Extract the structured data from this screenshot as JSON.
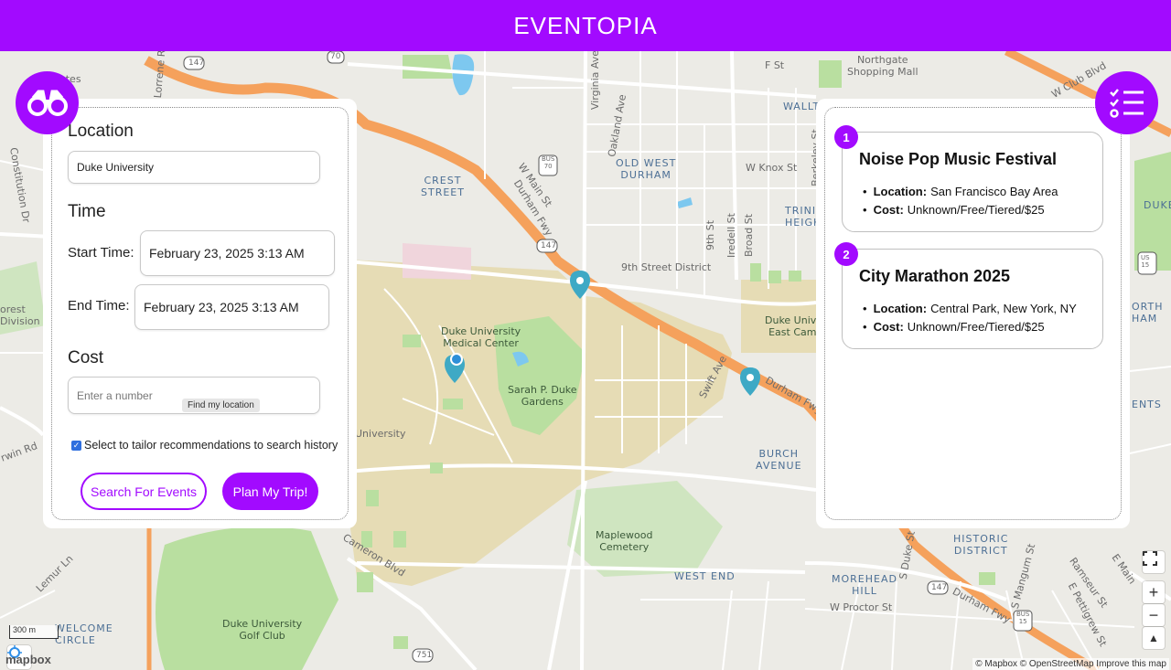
{
  "app": {
    "title": "EVENTOPIA",
    "brand_color": "#a20aff"
  },
  "search_panel": {
    "location_heading": "Location",
    "location_value": "Duke University",
    "time_heading": "Time",
    "start_label": "Start Time:",
    "start_value": "February 23, 2025 3:13 AM",
    "end_label": "End Time:",
    "end_value": "February 23, 2025 3:13 AM",
    "cost_heading": "Cost",
    "cost_placeholder": "Enter a number",
    "tooltip": "Find my location",
    "checkbox_label": "Select to tailor recommendations to search history",
    "checkbox_checked": true,
    "search_button": "Search For Events",
    "plan_button": "Plan My Trip!"
  },
  "results": {
    "items": [
      {
        "number": "1",
        "title": "Noise Pop Music Festival",
        "location_label": "Location:",
        "location": "San Francisco Bay Area",
        "cost_label": "Cost:",
        "cost": "Unknown/Free/Tiered/$25"
      },
      {
        "number": "2",
        "title": "City Marathon 2025",
        "location_label": "Location:",
        "location": "Central Park, New York, NY",
        "cost_label": "Cost:",
        "cost": "Unknown/Free/Tiered/$25"
      }
    ]
  },
  "map": {
    "labels": {
      "northgate": "Northgate\nShopping Mall",
      "old_west_durham": "OLD WEST\nDURHAM",
      "crest_street": "CREST\nSTREET",
      "ninth_street": "9th Street District",
      "duke_med": "Duke University\nMedical Center",
      "sarah_duke": "Sarah P. Duke\nGardens",
      "burch_avenue": "BURCH\nAVENUE",
      "maplewood": "Maplewood\nCemetery",
      "west_end": "WEST END",
      "morehead_hill": "MOREHEAD\nHILL",
      "historic_district": "HISTORIC\nDISTRICT",
      "duke_golf": "Duke University\nGolf Club",
      "welcome_circle": "WELCOME\nCIRCLE",
      "duke_east": "Duke Univer\nEast Camp",
      "trinity_heights": "TRINI\nHEIGH",
      "university": "University",
      "estates": "Estates",
      "walltown": "WALLT",
      "forest_division": "orest\nDivision",
      "duke_right": "DUKE",
      "north_ham": "ORTH\nHAM",
      "ents": "ENTS",
      "durham_fwy_1": "Durham Fwy",
      "durham_fwy_2": "Durham Fwy",
      "durham_fwy_3": "Durham Fwy",
      "w_main": "W Main St",
      "swift_ave": "Swift Ave",
      "broad_st": "Broad St",
      "ninth_st": "9th St",
      "iredell": "Iredell St",
      "berkeley": "Berkeley St",
      "oakland": "Oakland Ave",
      "virginia": "Virginia Ave",
      "w_knox": "W Knox St",
      "f_st": "F St",
      "w_club": "W Club Blvd",
      "cameron": "Cameron Blvd",
      "lemur": "Lemur Ln",
      "erwin": "rwin Rd",
      "constitution": "Constitution Dr",
      "lorrene": "Lorrene Rd",
      "w_proctor": "W Proctor St",
      "s_duke": "S Duke St",
      "s_mangum": "S Mangum St",
      "ramseur": "Ramseur St",
      "e_pettigrew": "E Pettigrew St",
      "e_main": "E Main",
      "r147a": "147",
      "r147b": "147",
      "r147c": "147",
      "r70": "70",
      "bus70": "BUS\n70",
      "r15": "15",
      "us15": "US\n15",
      "bus15": "BUS\n15",
      "r751": "751"
    },
    "scale": "300 m",
    "logo": "mapbox",
    "attribution": "© Mapbox © OpenStreetMap  Improve this map"
  }
}
